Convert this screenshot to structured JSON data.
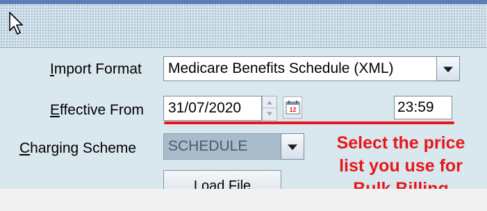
{
  "form": {
    "import_format": {
      "label_mnemonic": "I",
      "label_rest": "mport Format",
      "value": "Medicare Benefits Schedule (XML)"
    },
    "effective_from": {
      "label_mnemonic": "E",
      "label_rest": "ffective From",
      "date_value": "31/07/2020",
      "time_value": "23:59"
    },
    "charging_scheme": {
      "label_mnemonic": "C",
      "label_rest": "harging Scheme",
      "value": "SCHEDULE"
    },
    "load_file_label": "Load File"
  },
  "annotation": {
    "lines": [
      "Select the price",
      "list you use for",
      "Bulk Billing"
    ],
    "color": "#e8161a"
  },
  "icons": {
    "cursor": "arrow-cursor-icon",
    "calendar": "calendar-icon",
    "calendar_day": "12",
    "dropdown": "chevron-down-icon"
  }
}
